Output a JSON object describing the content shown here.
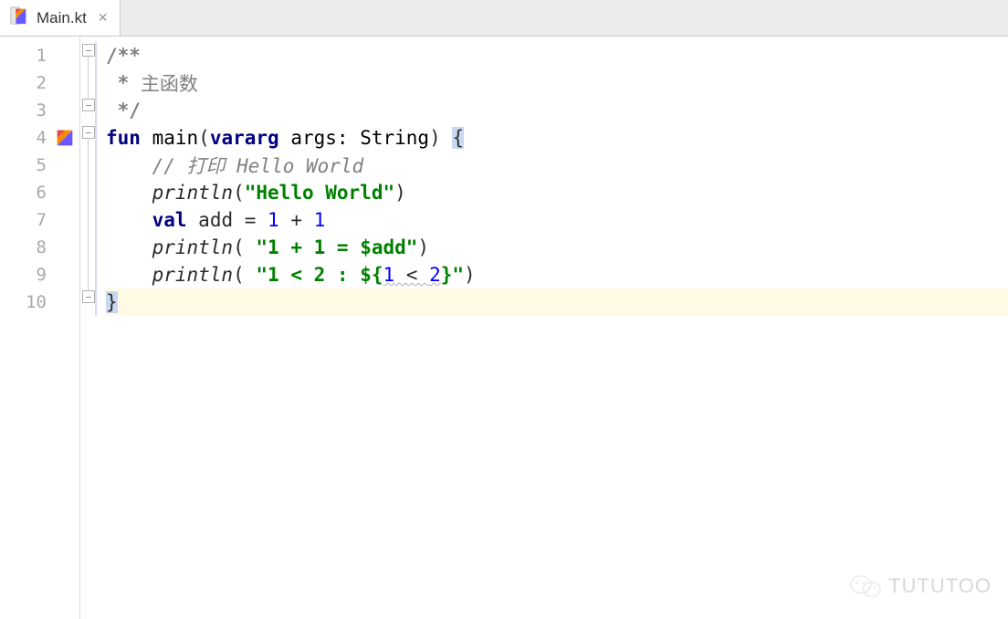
{
  "tab": {
    "filename": "Main.kt"
  },
  "gutter": {
    "numbers": [
      "1",
      "2",
      "3",
      "4",
      "5",
      "6",
      "7",
      "8",
      "9",
      "10"
    ]
  },
  "code": {
    "l1": {
      "doc_open": "/**"
    },
    "l2": {
      "star": " * ",
      "doc_text": "主函数"
    },
    "l3": {
      "doc_close": " */"
    },
    "l4": {
      "fun": "fun",
      "sp1": " ",
      "name": "main",
      "lp": "(",
      "vararg": "vararg",
      "sp2": " ",
      "arg": "args: String",
      "rp": ") ",
      "brace": "{"
    },
    "l5": {
      "indent": "    ",
      "comment": "// 打印 Hello World"
    },
    "l6": {
      "indent": "    ",
      "fn": "println",
      "lp": "(",
      "str": "\"Hello World\"",
      "rp": ")"
    },
    "l7": {
      "indent": "    ",
      "val": "val",
      "sp": " ",
      "decl": "add = ",
      "n1": "1",
      "op": " + ",
      "n2": "1"
    },
    "l8": {
      "indent": "    ",
      "fn": "println",
      "lp": "( ",
      "s1": "\"1 + 1 = ",
      "tpl": "$add",
      "s2": "\"",
      "rp": ")"
    },
    "l9": {
      "indent": "    ",
      "fn": "println",
      "lp": "( ",
      "s1": "\"1 < 2 : ",
      "tpl_open": "${",
      "e1": "1",
      "lt": " < ",
      "e2": "2",
      "tpl_close": "}",
      "s2": "\"",
      "rp": ")"
    },
    "l10": {
      "brace": "}"
    }
  },
  "watermark": {
    "text": "TUTUTOO"
  }
}
